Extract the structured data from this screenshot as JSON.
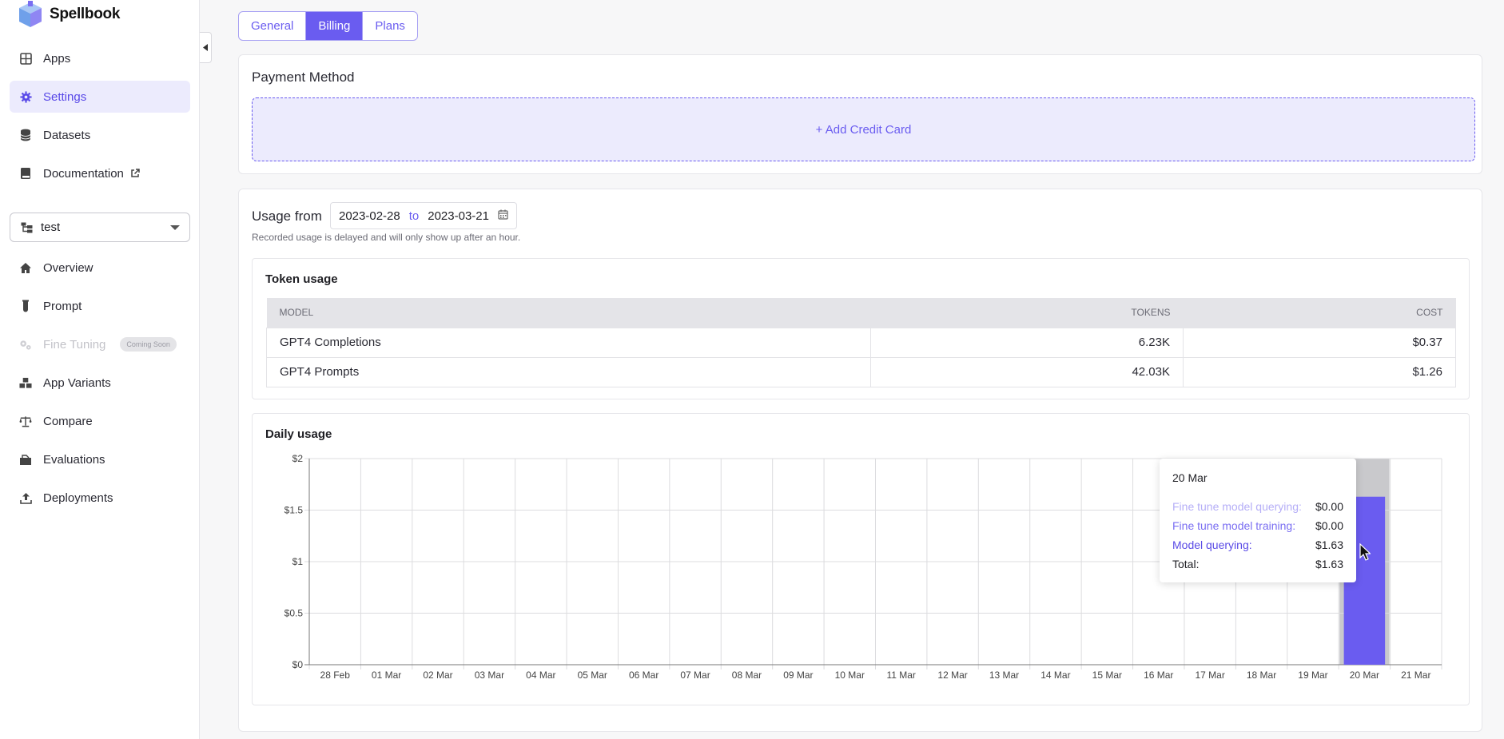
{
  "app": {
    "name": "Spellbook"
  },
  "sidebar": {
    "top_items": [
      {
        "label": "Apps",
        "icon": "grid-icon"
      },
      {
        "label": "Settings",
        "icon": "gear-icon",
        "active": true
      },
      {
        "label": "Datasets",
        "icon": "database-icon"
      },
      {
        "label": "Documentation",
        "icon": "book-icon",
        "external": true
      }
    ],
    "workspace": {
      "value": "test"
    },
    "items": [
      {
        "label": "Overview",
        "icon": "home-icon"
      },
      {
        "label": "Prompt",
        "icon": "flask-icon"
      },
      {
        "label": "Fine Tuning",
        "icon": "gears-icon",
        "disabled": true,
        "badge": "Coming Soon"
      },
      {
        "label": "App Variants",
        "icon": "boxes-icon"
      },
      {
        "label": "Compare",
        "icon": "scale-icon"
      },
      {
        "label": "Evaluations",
        "icon": "clipboard-icon"
      },
      {
        "label": "Deployments",
        "icon": "upload-icon"
      }
    ]
  },
  "tabs": [
    {
      "label": "General"
    },
    {
      "label": "Billing",
      "active": true
    },
    {
      "label": "Plans"
    }
  ],
  "payment": {
    "title": "Payment Method",
    "add_card": "+ Add Credit Card"
  },
  "usage": {
    "title": "Usage from",
    "from": "2023-02-28",
    "to_label": "to",
    "to": "2023-03-21",
    "note": "Recorded usage is delayed and will only show up after an hour."
  },
  "token_usage": {
    "title": "Token usage",
    "columns": [
      "MODEL",
      "TOKENS",
      "COST"
    ],
    "rows": [
      {
        "model": "GPT4 Completions",
        "tokens": "6.23K",
        "cost": "$0.37"
      },
      {
        "model": "GPT4 Prompts",
        "tokens": "42.03K",
        "cost": "$1.26"
      }
    ]
  },
  "daily_usage": {
    "title": "Daily usage"
  },
  "chart_data": {
    "type": "bar",
    "categories": [
      "28 Feb",
      "01 Mar",
      "02 Mar",
      "03 Mar",
      "04 Mar",
      "05 Mar",
      "06 Mar",
      "07 Mar",
      "08 Mar",
      "09 Mar",
      "10 Mar",
      "11 Mar",
      "12 Mar",
      "13 Mar",
      "14 Mar",
      "15 Mar",
      "16 Mar",
      "17 Mar",
      "18 Mar",
      "19 Mar",
      "20 Mar",
      "21 Mar"
    ],
    "series": [
      {
        "name": "Fine tune model querying",
        "values": [
          0,
          0,
          0,
          0,
          0,
          0,
          0,
          0,
          0,
          0,
          0,
          0,
          0,
          0,
          0,
          0,
          0,
          0,
          0,
          0,
          0,
          0
        ]
      },
      {
        "name": "Fine tune model training",
        "values": [
          0,
          0,
          0,
          0,
          0,
          0,
          0,
          0,
          0,
          0,
          0,
          0,
          0,
          0,
          0,
          0,
          0,
          0,
          0,
          0,
          0,
          0
        ]
      },
      {
        "name": "Model querying",
        "values": [
          0,
          0,
          0,
          0,
          0,
          0,
          0,
          0,
          0,
          0,
          0,
          0,
          0,
          0,
          0,
          0,
          0,
          0,
          0,
          0,
          1.63,
          0
        ]
      }
    ],
    "yticks": [
      "$0",
      "$0.5",
      "$1",
      "$1.5",
      "$2"
    ],
    "ylim": [
      0,
      2
    ],
    "grid": true,
    "highlight_index": 20,
    "bar_color": "#6a5cf0",
    "highlight_color": "#c9c9cc"
  },
  "tooltip": {
    "date": "20 Mar",
    "rows": [
      {
        "label": "Fine tune model querying:",
        "value": "$0.00"
      },
      {
        "label": "Fine tune model training:",
        "value": "$0.00"
      },
      {
        "label": "Model querying:",
        "value": "$1.63"
      },
      {
        "label": "Total:",
        "value": "$1.63"
      }
    ]
  }
}
